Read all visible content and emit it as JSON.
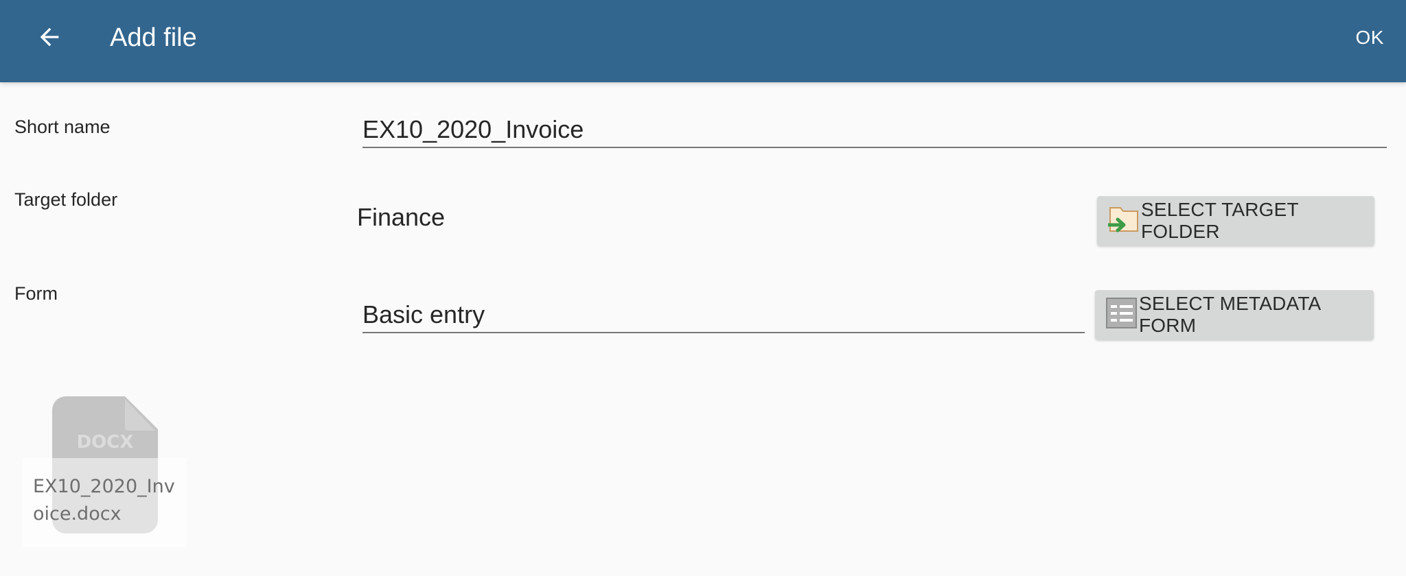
{
  "appbar": {
    "title": "Add file",
    "back_icon": "arrow-left-icon",
    "ok_label": "OK",
    "background_color": "#33668e"
  },
  "form": {
    "short_name": {
      "label": "Short name",
      "value": "EX10_2020_Invoice"
    },
    "target_folder": {
      "label": "Target folder",
      "value": "Finance",
      "button_label": "SELECT TARGET FOLDER",
      "button_icon": "folder-arrow-icon"
    },
    "form": {
      "label": "Form",
      "value": "Basic entry",
      "button_label": "SELECT METADATA FORM",
      "button_icon": "metadata-form-icon"
    }
  },
  "file": {
    "type_badge": "DOCX",
    "file_name": "EX10_2020_Invoice.docx",
    "icon": "document-icon"
  }
}
